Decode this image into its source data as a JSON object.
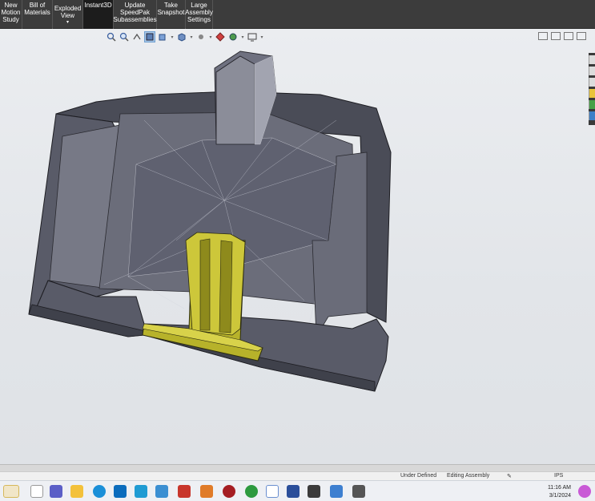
{
  "ribbon": {
    "items": [
      {
        "label": "New\nMotion\nStudy"
      },
      {
        "label": "Bill of\nMaterials"
      },
      {
        "label": "Exploded\nView"
      },
      {
        "label": "Instant3D"
      },
      {
        "label": "Update\nSpeedPak\nSubassemblies"
      },
      {
        "label": "Take\nSnapshot"
      },
      {
        "label": "Large\nAssembly\nSettings"
      }
    ],
    "exploded_caret": "▾"
  },
  "status": {
    "state": "Under Defined",
    "mode": "Editing Assembly",
    "units": "IPS"
  },
  "clock": {
    "time": "11:16 AM",
    "date": "3/1/2024"
  },
  "colors": {
    "ribbon_bg": "#3c3c3c",
    "housing": "#5d5f6c",
    "insert": "#b7b22a",
    "selection": "#a9c8e8"
  },
  "icons": [
    "zoom-to-fit-icon",
    "zoom-area-icon",
    "previous-view-icon",
    "section-view-icon",
    "view-orientation-icon",
    "display-style-icon",
    "hide-show-icon",
    "edit-appearance-icon",
    "apply-scene-icon",
    "view-settings-icon"
  ]
}
